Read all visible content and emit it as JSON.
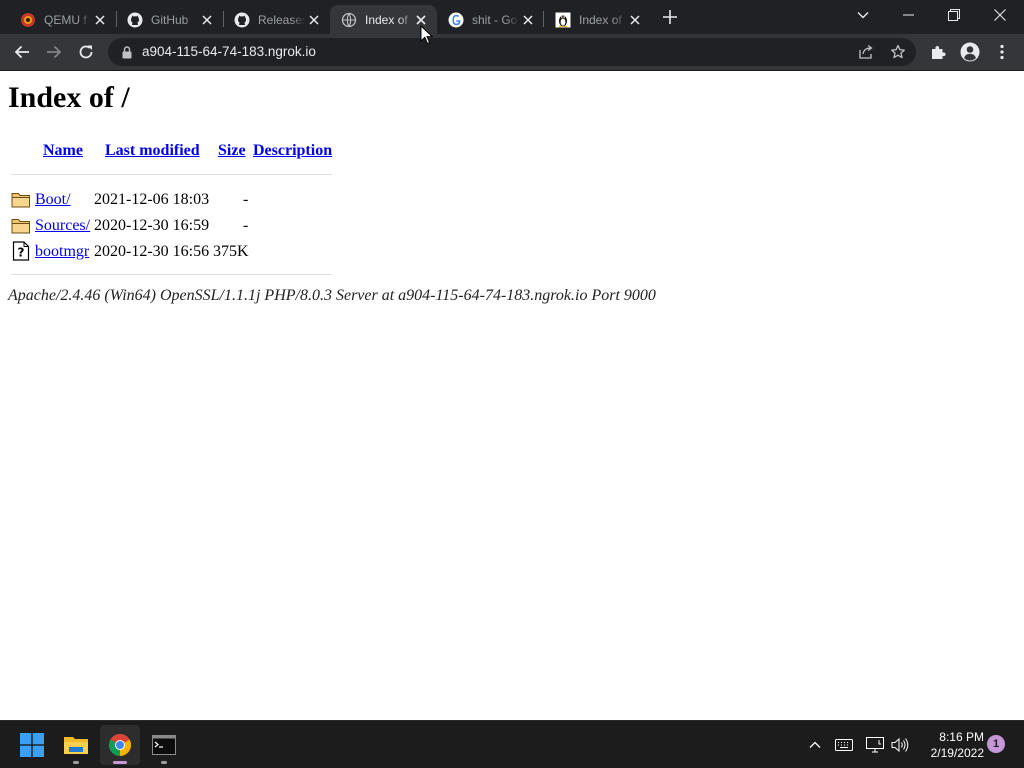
{
  "browser": {
    "tabs": [
      {
        "title": "QEMU f",
        "icon": "qemu-icon"
      },
      {
        "title": "GitHub",
        "icon": "github-icon"
      },
      {
        "title": "Releases",
        "icon": "github-icon"
      },
      {
        "title": "Index of",
        "icon": "globe-icon",
        "active": true
      },
      {
        "title": "shit - Go",
        "icon": "google-icon"
      },
      {
        "title": "Index of",
        "icon": "linux-penguin-icon"
      }
    ],
    "url": "a904-115-64-74-183.ngrok.io"
  },
  "page": {
    "title": "Index of /",
    "columns": [
      "Name",
      "Last modified",
      "Size",
      "Description"
    ],
    "rows": [
      {
        "icon": "folder-icon",
        "name": "Boot/",
        "modified": "2021-12-06 18:03",
        "size": "-",
        "description": ""
      },
      {
        "icon": "folder-icon",
        "name": "Sources/",
        "modified": "2020-12-30 16:59",
        "size": "-",
        "description": ""
      },
      {
        "icon": "unknown-file-icon",
        "name": "bootmgr",
        "modified": "2020-12-30 16:56",
        "size": "375K",
        "description": ""
      }
    ],
    "address": "Apache/2.4.46 (Win64) OpenSSL/1.1.1j PHP/8.0.3 Server at a904-115-64-74-183.ngrok.io Port 9000"
  },
  "taskbar": {
    "apps": [
      "windows-start-icon",
      "file-explorer-icon",
      "chrome-icon",
      "terminal-icon"
    ],
    "time": "8:16 PM",
    "date": "2/19/2022",
    "notification_count": "1"
  },
  "colors": {
    "chrome_dark": "#202124",
    "toolbar": "#35363a",
    "link": "#0000ee",
    "taskbar": "#1c1c1c"
  }
}
